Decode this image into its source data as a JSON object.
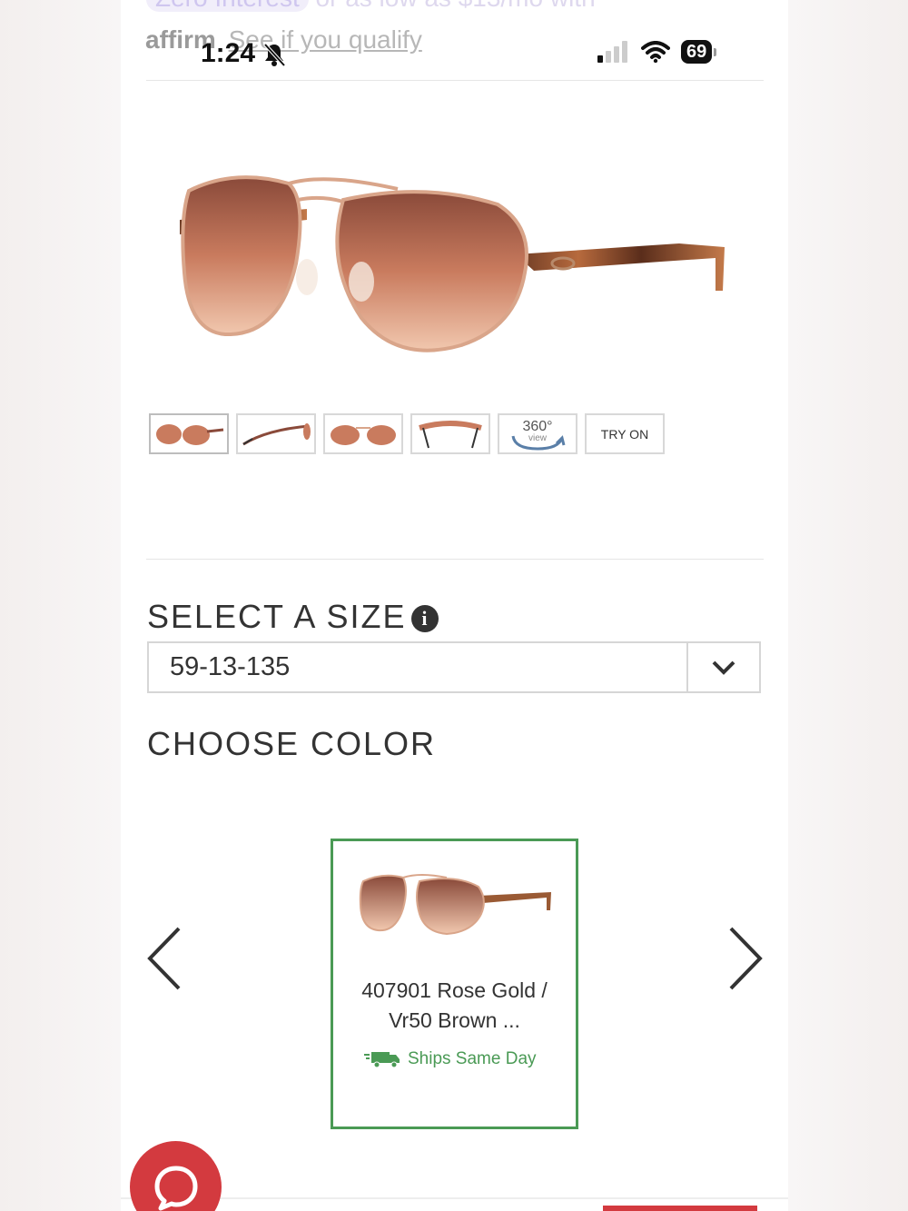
{
  "colors": {
    "accent_green": "#4a9a55",
    "chat_red": "#d33a3f",
    "text_dark": "#333333"
  },
  "affirm": {
    "top_pill": "Zero Interest",
    "top_text": "or as low as $13/mo with",
    "logo": "affirm",
    "link": "See if you qualify"
  },
  "status_bar": {
    "time": "1:24",
    "battery": "69",
    "icons": [
      "bell-slash-icon",
      "signal-icon",
      "wifi-icon",
      "battery-icon"
    ]
  },
  "gallery": {
    "thumbnails": [
      {
        "name": "front-angle",
        "active": true
      },
      {
        "name": "side-view"
      },
      {
        "name": "front-view"
      },
      {
        "name": "top-view"
      },
      {
        "name": "360-view",
        "label_top": "360°",
        "label_bottom": "view"
      },
      {
        "name": "try-on",
        "label": "TRY ON"
      }
    ]
  },
  "size": {
    "title": "SELECT A SIZE",
    "info_icon": "info-icon",
    "selected": "59-13-135"
  },
  "color": {
    "title": "CHOOSE COLOR",
    "selected_card": {
      "name": "407901 Rose Gold / Vr50 Brown ...",
      "shipping": "Ships Same Day"
    },
    "prev_icon": "chevron-left-icon",
    "next_icon": "chevron-right-icon"
  },
  "chat": {
    "icon": "chat-bubble-icon"
  }
}
